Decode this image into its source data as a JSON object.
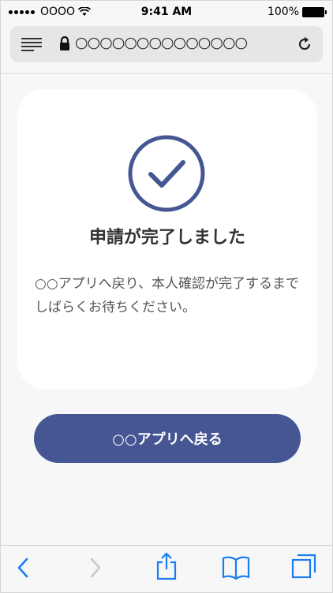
{
  "status_bar": {
    "carrier": "OOOO",
    "time": "9:41 AM",
    "battery_percent": "100%"
  },
  "address_bar": {
    "url": "○○○○○○○○○○○○○○"
  },
  "card": {
    "title": "申請が完了しました",
    "message": "○○アプリへ戻り、本人確認が完了するまでしばらくお待ちください。"
  },
  "return_button": {
    "label": "○○アプリへ戻る"
  },
  "colors": {
    "accent": "#455693",
    "ios_blue": "#1a7cf3",
    "background": "#f7f7f8"
  },
  "icons": {
    "check": "check-circle-icon",
    "back": "chevron-left-icon",
    "forward": "chevron-right-icon",
    "share": "share-icon",
    "bookmarks": "book-icon",
    "tabs": "tabs-icon"
  }
}
